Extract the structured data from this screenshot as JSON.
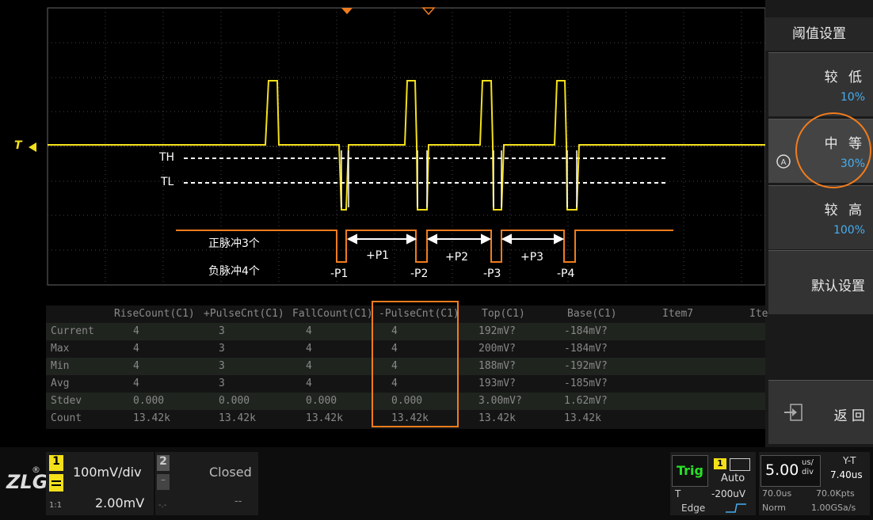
{
  "menu": {
    "title": "阈值设置",
    "items": [
      {
        "label": "较 低",
        "value": "10%"
      },
      {
        "label": "中 等",
        "value": "30%"
      },
      {
        "label": "较 高",
        "value": "100%"
      },
      {
        "label": "默认设置"
      }
    ],
    "back_label": "返 回"
  },
  "annotations": {
    "th": "TH",
    "tl": "TL",
    "pos_pulses": "正脉冲3个",
    "neg_pulses": "负脉冲4个",
    "p1": "+P1",
    "p2": "+P2",
    "p3": "+P3",
    "n1": "-P1",
    "n2": "-P2",
    "n3": "-P3",
    "n4": "-P4",
    "trigger_marker": "T"
  },
  "measure": {
    "columns": [
      "",
      "RiseCount(C1)",
      "+PulseCnt(C1)",
      "FallCount(C1)",
      "-PulseCnt(C1)",
      "Top(C1)",
      "Base(C1)",
      "Item7",
      "Ite"
    ],
    "rows": [
      [
        "Current",
        "4",
        "3",
        "4",
        "4",
        "192mV?",
        "-184mV?",
        "",
        ""
      ],
      [
        "Max",
        "4",
        "3",
        "4",
        "4",
        "200mV?",
        "-184mV?",
        "",
        ""
      ],
      [
        "Min",
        "4",
        "3",
        "4",
        "4",
        "188mV?",
        "-192mV?",
        "",
        ""
      ],
      [
        "Avg",
        "4",
        "3",
        "4",
        "4",
        "193mV?",
        "-185mV?",
        "",
        ""
      ],
      [
        "Stdev",
        "0.000",
        "0.000",
        "0.000",
        "0.000",
        "3.00mV?",
        "1.62mV?",
        "",
        ""
      ],
      [
        "Count",
        "13.42k",
        "13.42k",
        "13.42k",
        "13.42k",
        "13.42k",
        "13.42k",
        "",
        ""
      ]
    ]
  },
  "bottom": {
    "logo": "ZLG",
    "registered": "®",
    "ch1": {
      "num": "1",
      "scale": "100mV/div",
      "offset": "2.00mV",
      "probe": "1:1"
    },
    "ch2": {
      "num": "2",
      "state": "Closed",
      "offset": "--",
      "probe": "-.-"
    },
    "trig": {
      "label": "Trig",
      "ch": "1",
      "mode": "Auto",
      "t_label": "T",
      "level": "-200uV",
      "type": "Edge"
    },
    "timebase": {
      "scale": "5.00",
      "unit_top": "us/",
      "unit_bottom": "div",
      "mode_label": "Y-T",
      "pos": "7.40us",
      "window": "70.0us",
      "points": "70.0Kpts",
      "acq": "Norm",
      "rate": "1.00GSa/s"
    }
  },
  "colors": {
    "trace": "#f4e01a",
    "accent": "#f07c1e",
    "value_blue": "#46aef0"
  }
}
